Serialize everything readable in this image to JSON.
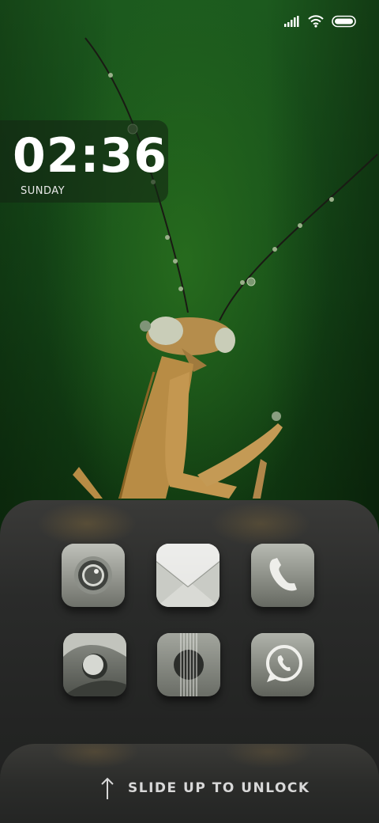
{
  "status_bar": {
    "icons": [
      "signal-icon",
      "wifi-icon",
      "battery-icon"
    ]
  },
  "clock": {
    "time": "02:36",
    "day": "SUNDAY"
  },
  "apps": [
    {
      "name": "camera",
      "icon": "camera-icon"
    },
    {
      "name": "mail",
      "icon": "mail-icon"
    },
    {
      "name": "phone",
      "icon": "phone-icon"
    },
    {
      "name": "browser",
      "icon": "browser-icon"
    },
    {
      "name": "music",
      "icon": "guitar-icon"
    },
    {
      "name": "whatsapp",
      "icon": "whatsapp-icon"
    }
  ],
  "unlock": {
    "label": "SLIDE UP TO UNLOCK",
    "icon": "arrow-up-icon"
  },
  "colors": {
    "wallpaper_green": "#1c5a1e",
    "panel_dark": "#2a2b2a",
    "icon_tile": "#8a8d86",
    "text_light": "#d8d8d8"
  }
}
